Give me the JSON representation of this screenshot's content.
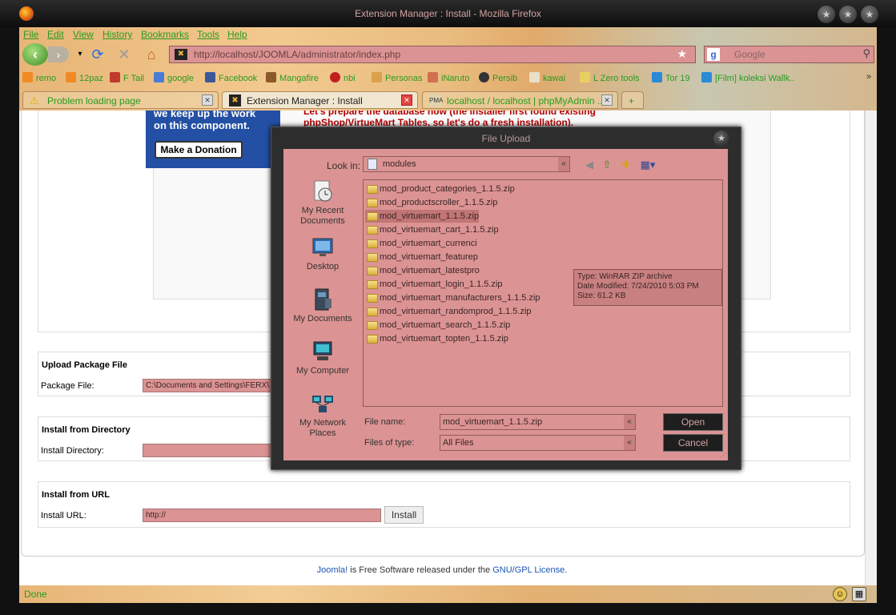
{
  "window": {
    "title": "Extension Manager : Install - Mozilla Firefox"
  },
  "menu": [
    "File",
    "Edit",
    "View",
    "History",
    "Bookmarks",
    "Tools",
    "Help"
  ],
  "nav": {
    "url": "http://localhost/JOOMLA/administrator/index.php",
    "search_placeholder": "Google"
  },
  "bookmarks": [
    "remo",
    "12paz",
    "F Tail",
    "google",
    "Facebook",
    "Mangafire",
    "nbi",
    "Personas",
    "iNaruto",
    "Persib",
    "kawai",
    "L Zero tools",
    "Tor 19",
    "[Film] koleksi Wallk.."
  ],
  "tabs": [
    {
      "label": "Problem loading page"
    },
    {
      "label": "Extension Manager : Install"
    },
    {
      "label": "localhost / localhost | phpMyAdmin ..."
    }
  ],
  "page": {
    "donate_text_1": "we keep up the work",
    "donate_text_2": "on this component.",
    "donate_button": "Make a Donation",
    "message_line_1": "Let's prepare the database now (the installer first found existing",
    "message_line_2": "phpShop/VirtueMart Tables, so let's do a fresh installation).",
    "upload": {
      "title": "Upload Package File",
      "label": "Package File:",
      "value": "C:\\Documents and Settings\\FERX\\"
    },
    "directory": {
      "title": "Install from Directory",
      "label": "Install Directory:"
    },
    "url_section": {
      "title": "Install from URL",
      "label": "Install URL:",
      "value": "http://",
      "button": "Install"
    },
    "footer": {
      "brand": "Joomla!",
      "middle": " is Free Software released under the ",
      "license": "GNU/GPL License",
      "end": "."
    }
  },
  "status": {
    "text": "Done"
  },
  "dialog": {
    "title": "File Upload",
    "look_in_label": "Look in:",
    "look_in_value": "modules",
    "places": [
      "My Recent Documents",
      "Desktop",
      "My Documents",
      "My Computer",
      "My Network Places"
    ],
    "files": [
      "mod_product_categories_1.1.5.zip",
      "mod_productscroller_1.1.5.zip",
      "mod_virtuemart_1.1.5.zip",
      "mod_virtuemart_cart_1.1.5.zip",
      "mod_virtuemart_currenci",
      "mod_virtuemart_featurep",
      "mod_virtuemart_latestpro",
      "mod_virtuemart_login_1.1.5.zip",
      "mod_virtuemart_manufacturers_1.1.5.zip",
      "mod_virtuemart_randomprod_1.1.5.zip",
      "mod_virtuemart_search_1.1.5.zip",
      "mod_virtuemart_topten_1.1.5.zip"
    ],
    "tooltip": {
      "type": "Type: WinRAR ZIP archive",
      "modified": "Date Modified: 7/24/2010 5:03 PM",
      "size": "Size: 61.2 KB"
    },
    "file_name_label": "File name:",
    "file_name_value": "mod_virtuemart_1.1.5.zip",
    "file_type_label": "Files of type:",
    "file_type_value": "All Files",
    "open_button": "Open",
    "cancel_button": "Cancel"
  }
}
